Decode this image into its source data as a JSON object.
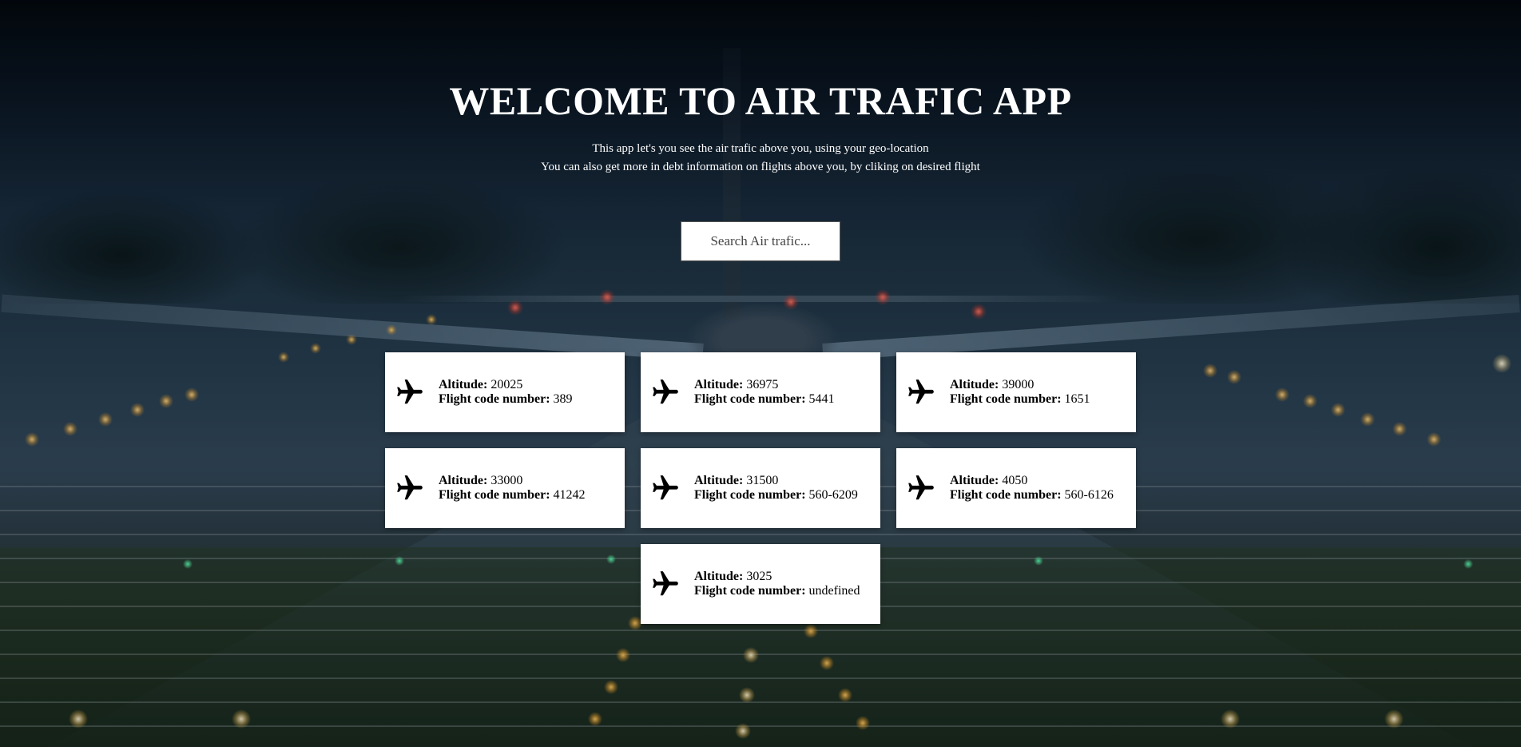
{
  "header": {
    "title": "WELCOME TO AIR TRAFIC APP",
    "subtitle_line1": "This app let's you see the air trafic above you, using your geo-location",
    "subtitle_line2": "You can also get more in debt information on flights above you, by cliking on desired flight"
  },
  "search": {
    "placeholder": "Search Air trafic..."
  },
  "labels": {
    "altitude": "Altitude:",
    "flight_code": "Flight code number:"
  },
  "flights": [
    {
      "icon": "airplane-icon",
      "altitude": "20025",
      "code": "389"
    },
    {
      "icon": "airplane-icon",
      "altitude": "36975",
      "code": "5441"
    },
    {
      "icon": "airplane-icon",
      "altitude": "39000",
      "code": "1651"
    },
    {
      "icon": "airplane-icon",
      "altitude": "33000",
      "code": "41242"
    },
    {
      "icon": "airplane-icon",
      "altitude": "31500",
      "code": "560-6209"
    },
    {
      "icon": "airplane-icon",
      "altitude": "4050",
      "code": "560-6126"
    },
    {
      "icon": "airplane-icon",
      "altitude": "3025",
      "code": "undefined"
    }
  ],
  "colors": {
    "card_bg": "#ffffff",
    "text_on_bg": "#ffffff",
    "text_on_card": "#000000"
  }
}
